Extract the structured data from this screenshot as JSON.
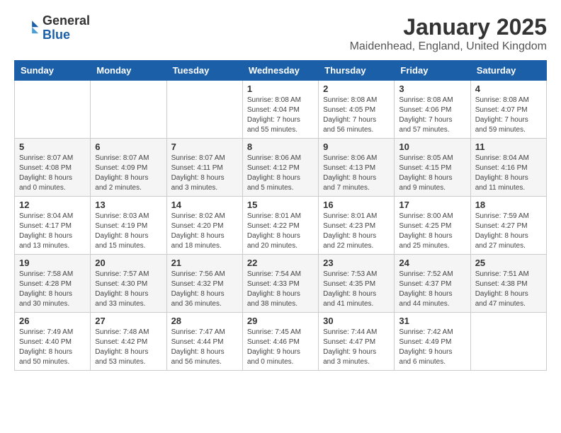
{
  "logo": {
    "general": "General",
    "blue": "Blue"
  },
  "title": "January 2025",
  "subtitle": "Maidenhead, England, United Kingdom",
  "days_of_week": [
    "Sunday",
    "Monday",
    "Tuesday",
    "Wednesday",
    "Thursday",
    "Friday",
    "Saturday"
  ],
  "weeks": [
    [
      {
        "day": "",
        "info": ""
      },
      {
        "day": "",
        "info": ""
      },
      {
        "day": "",
        "info": ""
      },
      {
        "day": "1",
        "info": "Sunrise: 8:08 AM\nSunset: 4:04 PM\nDaylight: 7 hours\nand 55 minutes."
      },
      {
        "day": "2",
        "info": "Sunrise: 8:08 AM\nSunset: 4:05 PM\nDaylight: 7 hours\nand 56 minutes."
      },
      {
        "day": "3",
        "info": "Sunrise: 8:08 AM\nSunset: 4:06 PM\nDaylight: 7 hours\nand 57 minutes."
      },
      {
        "day": "4",
        "info": "Sunrise: 8:08 AM\nSunset: 4:07 PM\nDaylight: 7 hours\nand 59 minutes."
      }
    ],
    [
      {
        "day": "5",
        "info": "Sunrise: 8:07 AM\nSunset: 4:08 PM\nDaylight: 8 hours\nand 0 minutes."
      },
      {
        "day": "6",
        "info": "Sunrise: 8:07 AM\nSunset: 4:09 PM\nDaylight: 8 hours\nand 2 minutes."
      },
      {
        "day": "7",
        "info": "Sunrise: 8:07 AM\nSunset: 4:11 PM\nDaylight: 8 hours\nand 3 minutes."
      },
      {
        "day": "8",
        "info": "Sunrise: 8:06 AM\nSunset: 4:12 PM\nDaylight: 8 hours\nand 5 minutes."
      },
      {
        "day": "9",
        "info": "Sunrise: 8:06 AM\nSunset: 4:13 PM\nDaylight: 8 hours\nand 7 minutes."
      },
      {
        "day": "10",
        "info": "Sunrise: 8:05 AM\nSunset: 4:15 PM\nDaylight: 8 hours\nand 9 minutes."
      },
      {
        "day": "11",
        "info": "Sunrise: 8:04 AM\nSunset: 4:16 PM\nDaylight: 8 hours\nand 11 minutes."
      }
    ],
    [
      {
        "day": "12",
        "info": "Sunrise: 8:04 AM\nSunset: 4:17 PM\nDaylight: 8 hours\nand 13 minutes."
      },
      {
        "day": "13",
        "info": "Sunrise: 8:03 AM\nSunset: 4:19 PM\nDaylight: 8 hours\nand 15 minutes."
      },
      {
        "day": "14",
        "info": "Sunrise: 8:02 AM\nSunset: 4:20 PM\nDaylight: 8 hours\nand 18 minutes."
      },
      {
        "day": "15",
        "info": "Sunrise: 8:01 AM\nSunset: 4:22 PM\nDaylight: 8 hours\nand 20 minutes."
      },
      {
        "day": "16",
        "info": "Sunrise: 8:01 AM\nSunset: 4:23 PM\nDaylight: 8 hours\nand 22 minutes."
      },
      {
        "day": "17",
        "info": "Sunrise: 8:00 AM\nSunset: 4:25 PM\nDaylight: 8 hours\nand 25 minutes."
      },
      {
        "day": "18",
        "info": "Sunrise: 7:59 AM\nSunset: 4:27 PM\nDaylight: 8 hours\nand 27 minutes."
      }
    ],
    [
      {
        "day": "19",
        "info": "Sunrise: 7:58 AM\nSunset: 4:28 PM\nDaylight: 8 hours\nand 30 minutes."
      },
      {
        "day": "20",
        "info": "Sunrise: 7:57 AM\nSunset: 4:30 PM\nDaylight: 8 hours\nand 33 minutes."
      },
      {
        "day": "21",
        "info": "Sunrise: 7:56 AM\nSunset: 4:32 PM\nDaylight: 8 hours\nand 36 minutes."
      },
      {
        "day": "22",
        "info": "Sunrise: 7:54 AM\nSunset: 4:33 PM\nDaylight: 8 hours\nand 38 minutes."
      },
      {
        "day": "23",
        "info": "Sunrise: 7:53 AM\nSunset: 4:35 PM\nDaylight: 8 hours\nand 41 minutes."
      },
      {
        "day": "24",
        "info": "Sunrise: 7:52 AM\nSunset: 4:37 PM\nDaylight: 8 hours\nand 44 minutes."
      },
      {
        "day": "25",
        "info": "Sunrise: 7:51 AM\nSunset: 4:38 PM\nDaylight: 8 hours\nand 47 minutes."
      }
    ],
    [
      {
        "day": "26",
        "info": "Sunrise: 7:49 AM\nSunset: 4:40 PM\nDaylight: 8 hours\nand 50 minutes."
      },
      {
        "day": "27",
        "info": "Sunrise: 7:48 AM\nSunset: 4:42 PM\nDaylight: 8 hours\nand 53 minutes."
      },
      {
        "day": "28",
        "info": "Sunrise: 7:47 AM\nSunset: 4:44 PM\nDaylight: 8 hours\nand 56 minutes."
      },
      {
        "day": "29",
        "info": "Sunrise: 7:45 AM\nSunset: 4:46 PM\nDaylight: 9 hours\nand 0 minutes."
      },
      {
        "day": "30",
        "info": "Sunrise: 7:44 AM\nSunset: 4:47 PM\nDaylight: 9 hours\nand 3 minutes."
      },
      {
        "day": "31",
        "info": "Sunrise: 7:42 AM\nSunset: 4:49 PM\nDaylight: 9 hours\nand 6 minutes."
      },
      {
        "day": "",
        "info": ""
      }
    ]
  ]
}
